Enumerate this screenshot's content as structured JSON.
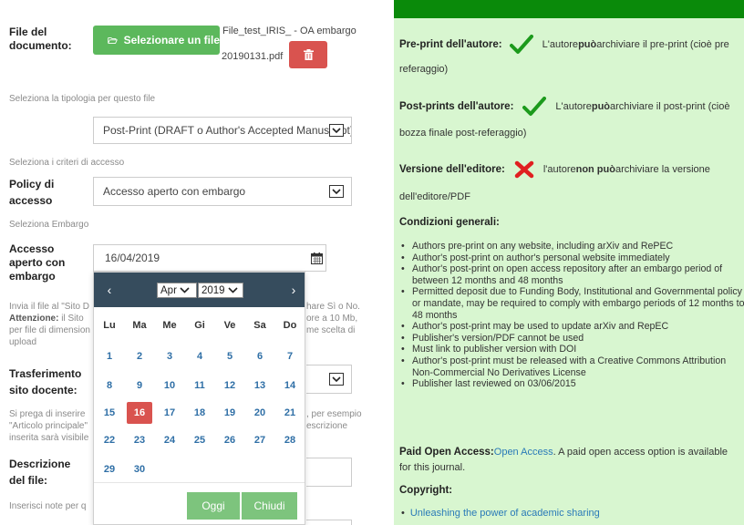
{
  "form": {
    "file_label": "File del documento:",
    "select_file_button": "Selezionare un file",
    "file_name_line1": "File_test_IRIS_ - OA embargo",
    "file_name_line2": "20190131.pdf",
    "type_hint": "Seleziona la tipologia per questo file",
    "type_value": "Post-Print (DRAFT o Author's Accepted Manuscript)",
    "access_hint": "Seleziona i criteri di accesso",
    "policy_label_1": "Policy di",
    "policy_label_2": "accesso",
    "policy_value": "Accesso aperto con embargo",
    "embargo_hint": "Seleziona Embargo",
    "open_label_1": "Accesso",
    "open_label_2": "aperto con",
    "open_label_3": "embargo",
    "date_value": "16/04/2019",
    "upload_hint_1a": "Invia il file al \"Sito D",
    "upload_hint_1b": "hare Sì o No.",
    "upload_hint_2a_bold": "Attenzione:",
    "upload_hint_2a": " il Sito",
    "upload_hint_2b": "ore a 10 Mb,",
    "upload_hint_3a": "per file di dimension",
    "upload_hint_3b": "me scelta di",
    "upload_hint_4": "upload",
    "transfer_label_1": "Trasferimento",
    "transfer_label_2": "sito docente:",
    "desc_hint_1a": "Si prega di inserire",
    "desc_hint_1b": ", per esempio",
    "desc_hint_2a": "\"Articolo principale\"",
    "desc_hint_2b": "escrizione",
    "desc_hint_3": "inserita sarà visibile",
    "desc_label_1": "Descrizione",
    "desc_label_2": "del file:",
    "notes_hint": "Inserisci note per q"
  },
  "datepicker": {
    "month": "Apr",
    "year": "2019",
    "weekdays": [
      "Lu",
      "Ma",
      "Me",
      "Gi",
      "Ve",
      "Sa",
      "Do"
    ],
    "weeks": [
      [
        "1",
        "2",
        "3",
        "4",
        "5",
        "6",
        "7"
      ],
      [
        "8",
        "9",
        "10",
        "11",
        "12",
        "13",
        "14"
      ],
      [
        "15",
        "16",
        "17",
        "18",
        "19",
        "20",
        "21"
      ],
      [
        "22",
        "23",
        "24",
        "25",
        "26",
        "27",
        "28"
      ],
      [
        "29",
        "30"
      ]
    ],
    "selected_day": "16",
    "today_button": "Oggi",
    "close_button": "Chiudi"
  },
  "panel": {
    "preprint_title": "Pre-print dell'autore:",
    "preprint_text_a": "L'autore ",
    "preprint_text_bold": "può",
    "preprint_text_b": " archiviare il pre-print (cioè pre",
    "preprint_text_2": "referaggio)",
    "postprint_title": "Post-prints dell'autore:",
    "postprint_text_a": "L'autore",
    "postprint_text_bold": "può",
    "postprint_text_b": " archiviare il post-print (cioè",
    "postprint_text_2": "bozza finale post-referaggio)",
    "publisher_title": "Versione dell'editore:",
    "publisher_text_a": "l'autore ",
    "publisher_text_bold": "non può",
    "publisher_text_b": " archiviare la versione",
    "publisher_text_2": "dell'editore/PDF",
    "conditions_title": "Condizioni generali:",
    "conditions": [
      "Authors pre-print on any website, including arXiv and RePEC",
      "Author's post-print on author's personal website immediately",
      "Author's post-print on open access repository after an embargo period of between 12 months and 48 months",
      "Permitted deposit due to Funding Body, Institutional and Governmental policy or mandate, may be required to comply with embargo periods of 12 months to 48 months",
      "Author's post-print may be used to update arXiv and RepEC",
      "Publisher's version/PDF cannot be used",
      "Must link to publisher version with DOI",
      "Author's post-print must be released with a Creative Commons Attribution Non-Commercial No Derivatives License",
      "Publisher last reviewed on 03/06/2015"
    ],
    "paid_title": "Paid Open Access:",
    "paid_link": "Open Access",
    "paid_text": ". A paid open access option is available",
    "paid_text_2": "for this journal.",
    "copyright_title": "Copyright:",
    "copyright_link": "Unleashing the power of academic sharing"
  },
  "icons": {
    "folder": "folder-open-icon",
    "trash": "trash-icon",
    "calendar": "calendar-icon",
    "check": "check-icon",
    "cross": "cross-icon"
  },
  "colors": {
    "green_button": "#5cb85c",
    "red_button": "#d9534f",
    "panel_bg": "#d8f6d0",
    "panel_bar": "#0a8a0a",
    "datepicker_header": "#364c5d",
    "check": "#1c9a1c",
    "cross": "#e02020"
  }
}
